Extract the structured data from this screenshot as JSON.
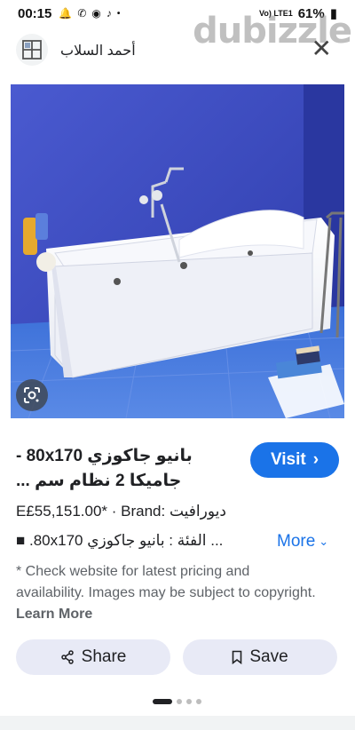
{
  "status_bar": {
    "time": "00:15",
    "battery": "61%",
    "network": "Vo) LTE1"
  },
  "watermark": "dubizzle",
  "header": {
    "site_name": "أحمد السلاب",
    "close_symbol": "✕"
  },
  "product": {
    "title": "بانيو جاكوزي 80x170 - جاميكا 2 نظام سم ...",
    "visit_label": "Visit",
    "price_line": "E£55,151.00* · Brand: ديورافيت",
    "description": "... الفئة : بانيو جاكوزي 80x170. ■",
    "more_label": "More"
  },
  "disclaimer": {
    "text": "* Check website for latest pricing and availability. Images may be subject to copyright. ",
    "learn_more": "Learn More"
  },
  "actions": {
    "share_label": "Share",
    "save_label": "Save"
  },
  "icons": {
    "logo": "site-logo-icon",
    "close": "close-icon",
    "lens": "google-lens-icon",
    "share": "share-icon",
    "save": "bookmark-icon"
  },
  "colors": {
    "accent": "#1a73e8",
    "pill_bg": "#e8eaf6",
    "wall_blue": "#3a49b8"
  }
}
